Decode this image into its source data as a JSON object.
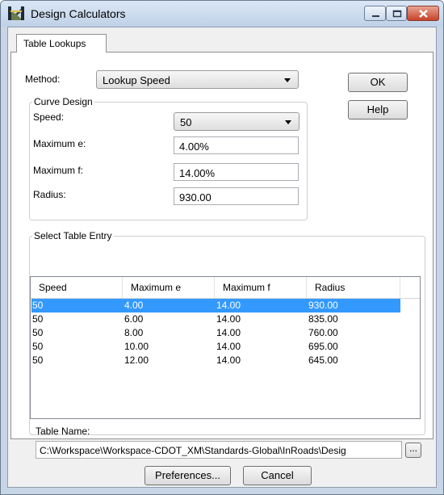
{
  "window": {
    "title": "Design Calculators"
  },
  "tabs": [
    {
      "label": "Table Lookups"
    }
  ],
  "method": {
    "label": "Method:",
    "value": "Lookup Speed"
  },
  "buttons": {
    "ok": "OK",
    "help": "Help",
    "preferences": "Preferences...",
    "cancel": "Cancel",
    "browse": "..."
  },
  "curve_design": {
    "legend": "Curve Design",
    "speed_label": "Speed:",
    "speed_value": "50",
    "max_e_label": "Maximum e:",
    "max_e_value": "4.00%",
    "max_f_label": "Maximum f:",
    "max_f_value": "14.00%",
    "radius_label": "Radius:",
    "radius_value": "930.00"
  },
  "table": {
    "legend": "Select Table Entry",
    "columns": [
      "Speed",
      "Maximum e",
      "Maximum f",
      "Radius"
    ],
    "rows": [
      [
        "50",
        "4.00",
        "14.00",
        "930.00"
      ],
      [
        "50",
        "6.00",
        "14.00",
        "835.00"
      ],
      [
        "50",
        "8.00",
        "14.00",
        "760.00"
      ],
      [
        "50",
        "10.00",
        "14.00",
        "695.00"
      ],
      [
        "50",
        "12.00",
        "14.00",
        "645.00"
      ]
    ],
    "selected_index": 0
  },
  "table_name": {
    "label": "Table Name:",
    "value": "C:\\Workspace\\Workspace-CDOT_XM\\Standards-Global\\InRoads\\Desig"
  },
  "icons": {
    "app": "design-calculator-icon",
    "minimize": "minimize-icon",
    "maximize": "maximize-icon",
    "close": "close-icon",
    "dropdown": "chevron-down-icon"
  },
  "colors": {
    "selection": "#3399ff",
    "titlebar": "#c7d5e7",
    "close": "#c7432a"
  }
}
